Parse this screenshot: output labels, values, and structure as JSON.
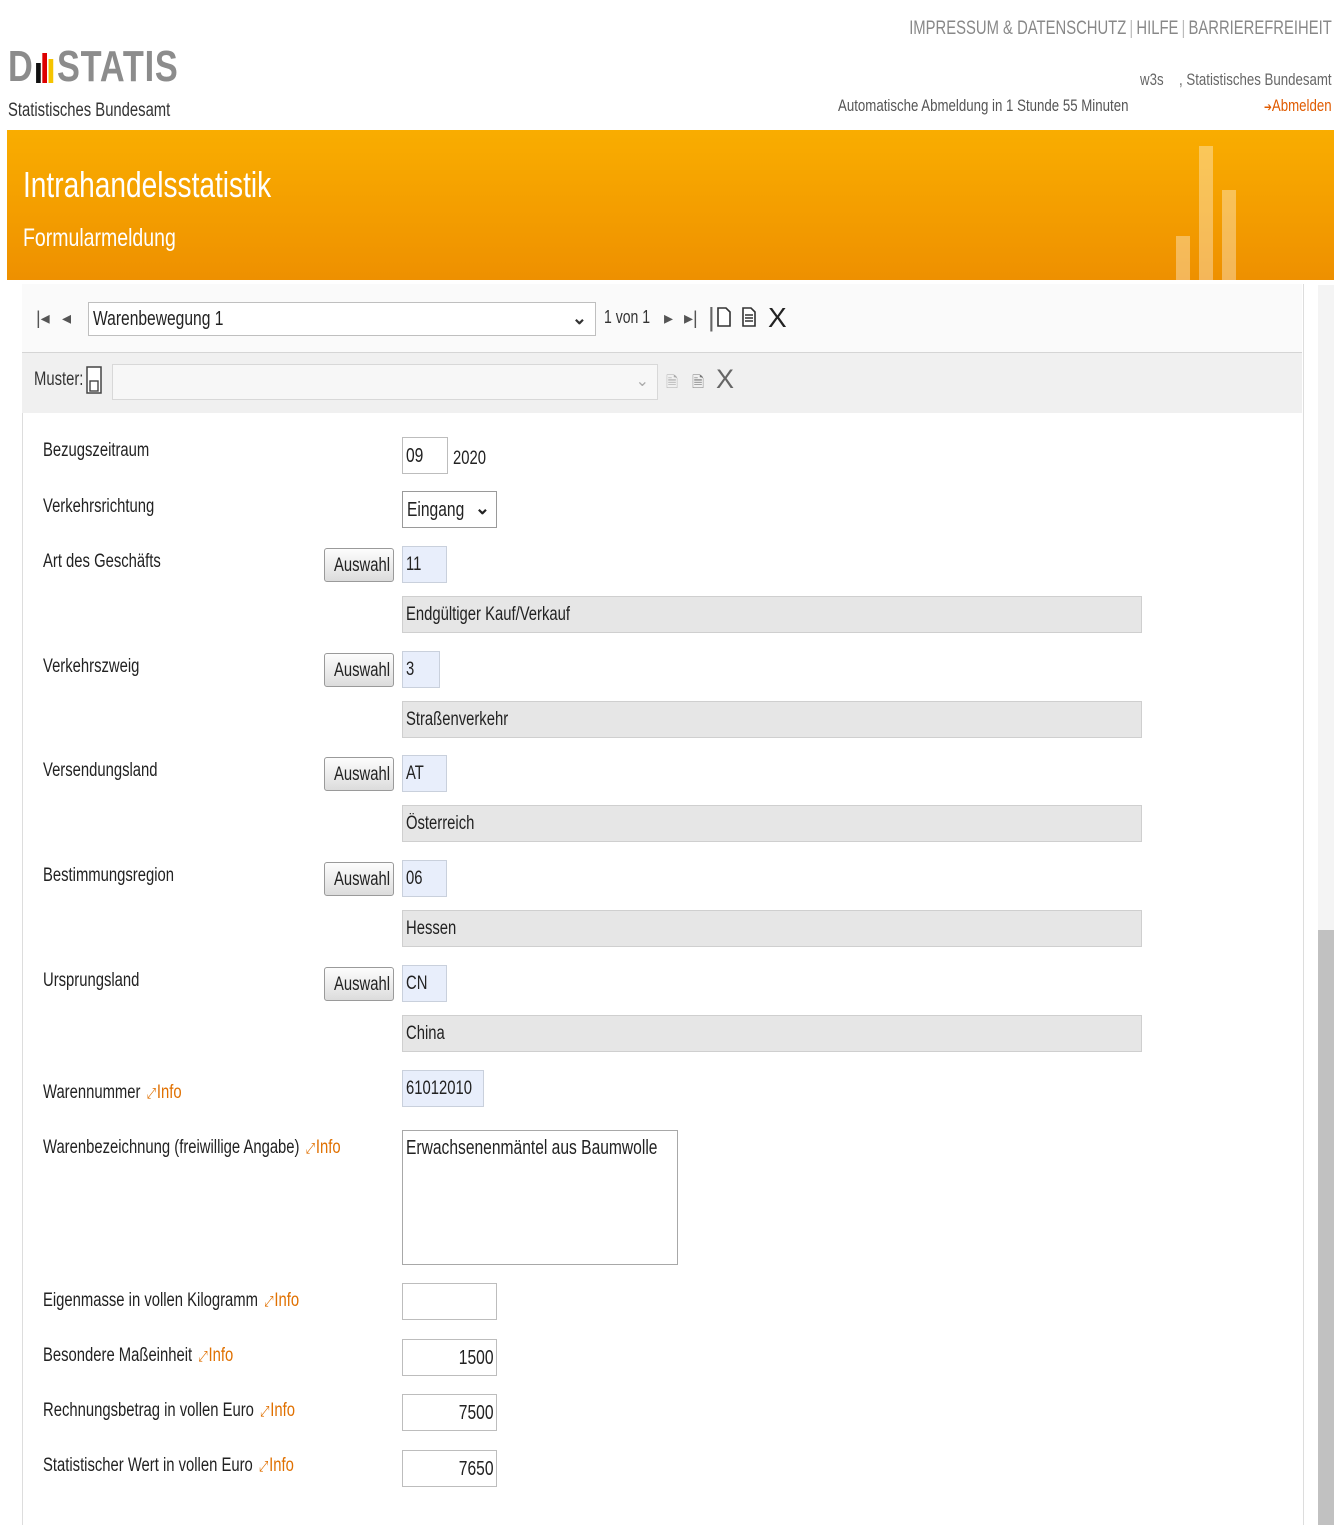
{
  "header": {
    "logo_left": "D",
    "logo_right": "STATIS",
    "logo_sub": "Statistisches Bundesamt",
    "links": [
      "IMPRESSUM & DATENSCHUTZ",
      "HILFE",
      "BARRIEREFREIHEIT"
    ],
    "user_id": "w3s",
    "user_org": ", Statistisches Bundesamt",
    "logout_note": "Automatische Abmeldung in 1 Stunde 55 Minuten",
    "logout_label": "Abmelden",
    "logout_arrow": "➔"
  },
  "banner": {
    "title": "Intrahandelsstatistik",
    "subtitle": "Formularmeldung"
  },
  "navigation": {
    "selected": "Warenbewegung 1",
    "count": "1 von 1"
  },
  "muster": {
    "label": "Muster:",
    "value": ""
  },
  "form": {
    "bezugszeitraum": {
      "label": "Bezugszeitraum",
      "month": "09",
      "year": "2020"
    },
    "verkehrsrichtung": {
      "label": "Verkehrsrichtung",
      "value": "Eingang"
    },
    "select_button": "Auswahl",
    "info_label": "Info",
    "rows": [
      {
        "label": "Art des Geschäfts",
        "code": "11",
        "description": "Endgültiger Kauf/Verkauf"
      },
      {
        "label": "Verkehrszweig",
        "code": "3",
        "description": "Straßenverkehr"
      },
      {
        "label": "Versendungsland",
        "code": "AT",
        "description": "Österreich"
      },
      {
        "label": "Bestimmungsregion",
        "code": "06",
        "description": "Hessen"
      },
      {
        "label": "Ursprungsland",
        "code": "CN",
        "description": "China"
      }
    ],
    "warennummer": {
      "label": "Warennummer",
      "value": "61012010"
    },
    "warenbezeichnung": {
      "label": "Warenbezeichnung (freiwillige Angabe)",
      "value": "Erwachsenenmäntel aus Baumwolle"
    },
    "eigenmasse": {
      "label": "Eigenmasse in vollen Kilogramm",
      "value": ""
    },
    "masseinheit": {
      "label": "Besondere Maßeinheit",
      "value": "1500"
    },
    "rechnungsbetrag": {
      "label": "Rechnungsbetrag in vollen Euro",
      "value": "7500"
    },
    "statistischer_wert": {
      "label": "Statistischer Wert in vollen Euro",
      "value": "7650"
    }
  },
  "colors": {
    "accent": "#f5a300",
    "link": "#e07000",
    "code_field": "#e8eefb",
    "desc_field": "#e6e6e6"
  }
}
